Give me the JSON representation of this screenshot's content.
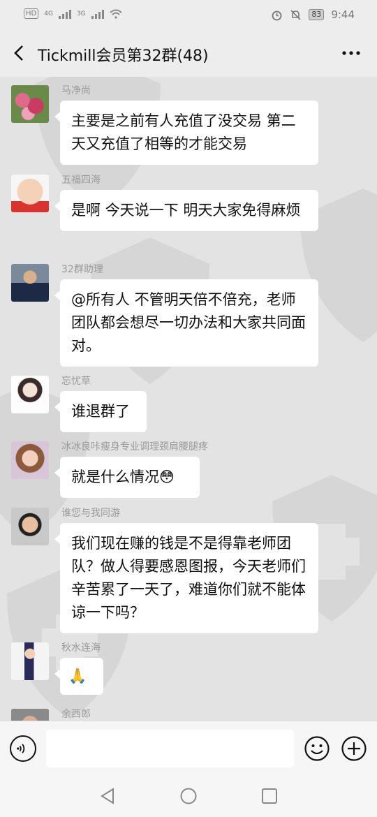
{
  "status_bar": {
    "hd": "HD",
    "net1": "4G",
    "net2": "3G",
    "battery": "83",
    "time": "9:44"
  },
  "header": {
    "title": "Tickmill会员第32群(48)"
  },
  "messages": [
    {
      "sender": "马净尚",
      "text": "主要是之前有人充值了没交易 第二天又充值了相等的才能交易"
    },
    {
      "sender": "五福四海",
      "text": "是啊 今天说一下 明天大家免得麻烦"
    },
    {
      "sender": "32群助理",
      "text": "@所有人  不管明天倍不倍充，老师团队都会想尽一切办法和大家共同面对。"
    },
    {
      "sender": "忘忧草",
      "text": "谁退群了"
    },
    {
      "sender": "冰冰良咔瘦身专业调理颈肩腰腿疼",
      "text": "就是什么情况😳"
    },
    {
      "sender": "谁您与我同游",
      "text": "我们现在赚的钱是不是得靠老师团队？做人得要感恩图报，今天老师们辛苦累了一天了，难道你们就不能体谅一下吗？"
    },
    {
      "sender": "秋水连海",
      "text": "🙏"
    },
    {
      "sender": "余西郎",
      "text": ""
    }
  ],
  "input": {
    "placeholder": ""
  },
  "colors": {
    "background": "#ededed",
    "chat_background": "#e3e3e3",
    "bubble": "#ffffff"
  }
}
